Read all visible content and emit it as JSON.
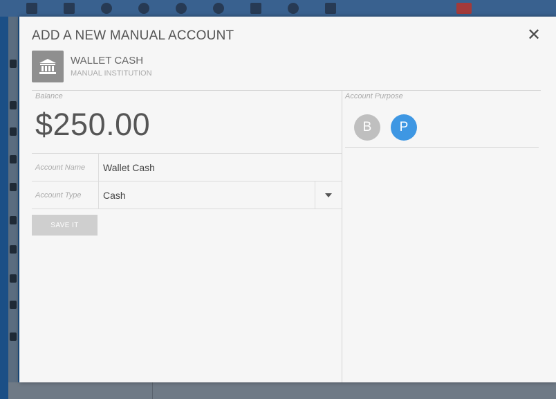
{
  "modal": {
    "title": "ADD A NEW MANUAL ACCOUNT",
    "close_icon": "close-x-icon"
  },
  "institution": {
    "icon": "bank-building-icon",
    "name": "WALLET CASH",
    "type": "MANUAL INSTITUTION"
  },
  "balance": {
    "label": "Balance",
    "value": "$250.00"
  },
  "form": {
    "account_name_label": "Account Name",
    "account_name_value": "Wallet Cash",
    "account_type_label": "Account Type",
    "account_type_value": "Cash",
    "save_label": "SAVE IT"
  },
  "purpose": {
    "label": "Account Purpose",
    "options": [
      {
        "label": "B",
        "selected": false,
        "color": "#bfbfbf"
      },
      {
        "label": "P",
        "selected": true,
        "color": "#3e97e3"
      }
    ]
  },
  "colors": {
    "accent": "#3e97e3",
    "modal_bg": "#f6f6f6",
    "backdrop": "#1b4f86"
  }
}
